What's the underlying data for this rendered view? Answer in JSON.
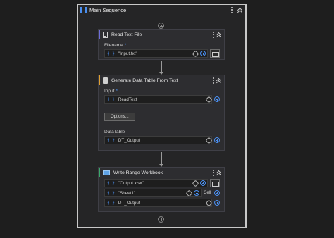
{
  "sequence": {
    "title": "Main Sequence"
  },
  "read_text": {
    "title": "Read Text File",
    "filename_label": "Filename",
    "required_mark": "*",
    "filename_value": "\"Input.txt\"",
    "bracket": "{ }"
  },
  "generate_table": {
    "title": "Generate Data Table From Text",
    "input_label": "Input",
    "required_mark": "*",
    "input_value": "ReadText",
    "options_button": "Options...",
    "datatable_label": "DataTable",
    "datatable_value": "DT_Output",
    "bracket": "{ }"
  },
  "write_range": {
    "title": "Write Range Workbook",
    "workbook_value": "\"Output.xlsx\"",
    "sheet_value": "\"Sheet1\"",
    "cell_label": "Cell",
    "datatable_value": "DT_Output",
    "bracket": "{ }"
  },
  "colors": {
    "accent": "#4a8ff0",
    "border": "#c8c8c8",
    "card_bg": "#2d2d30"
  }
}
